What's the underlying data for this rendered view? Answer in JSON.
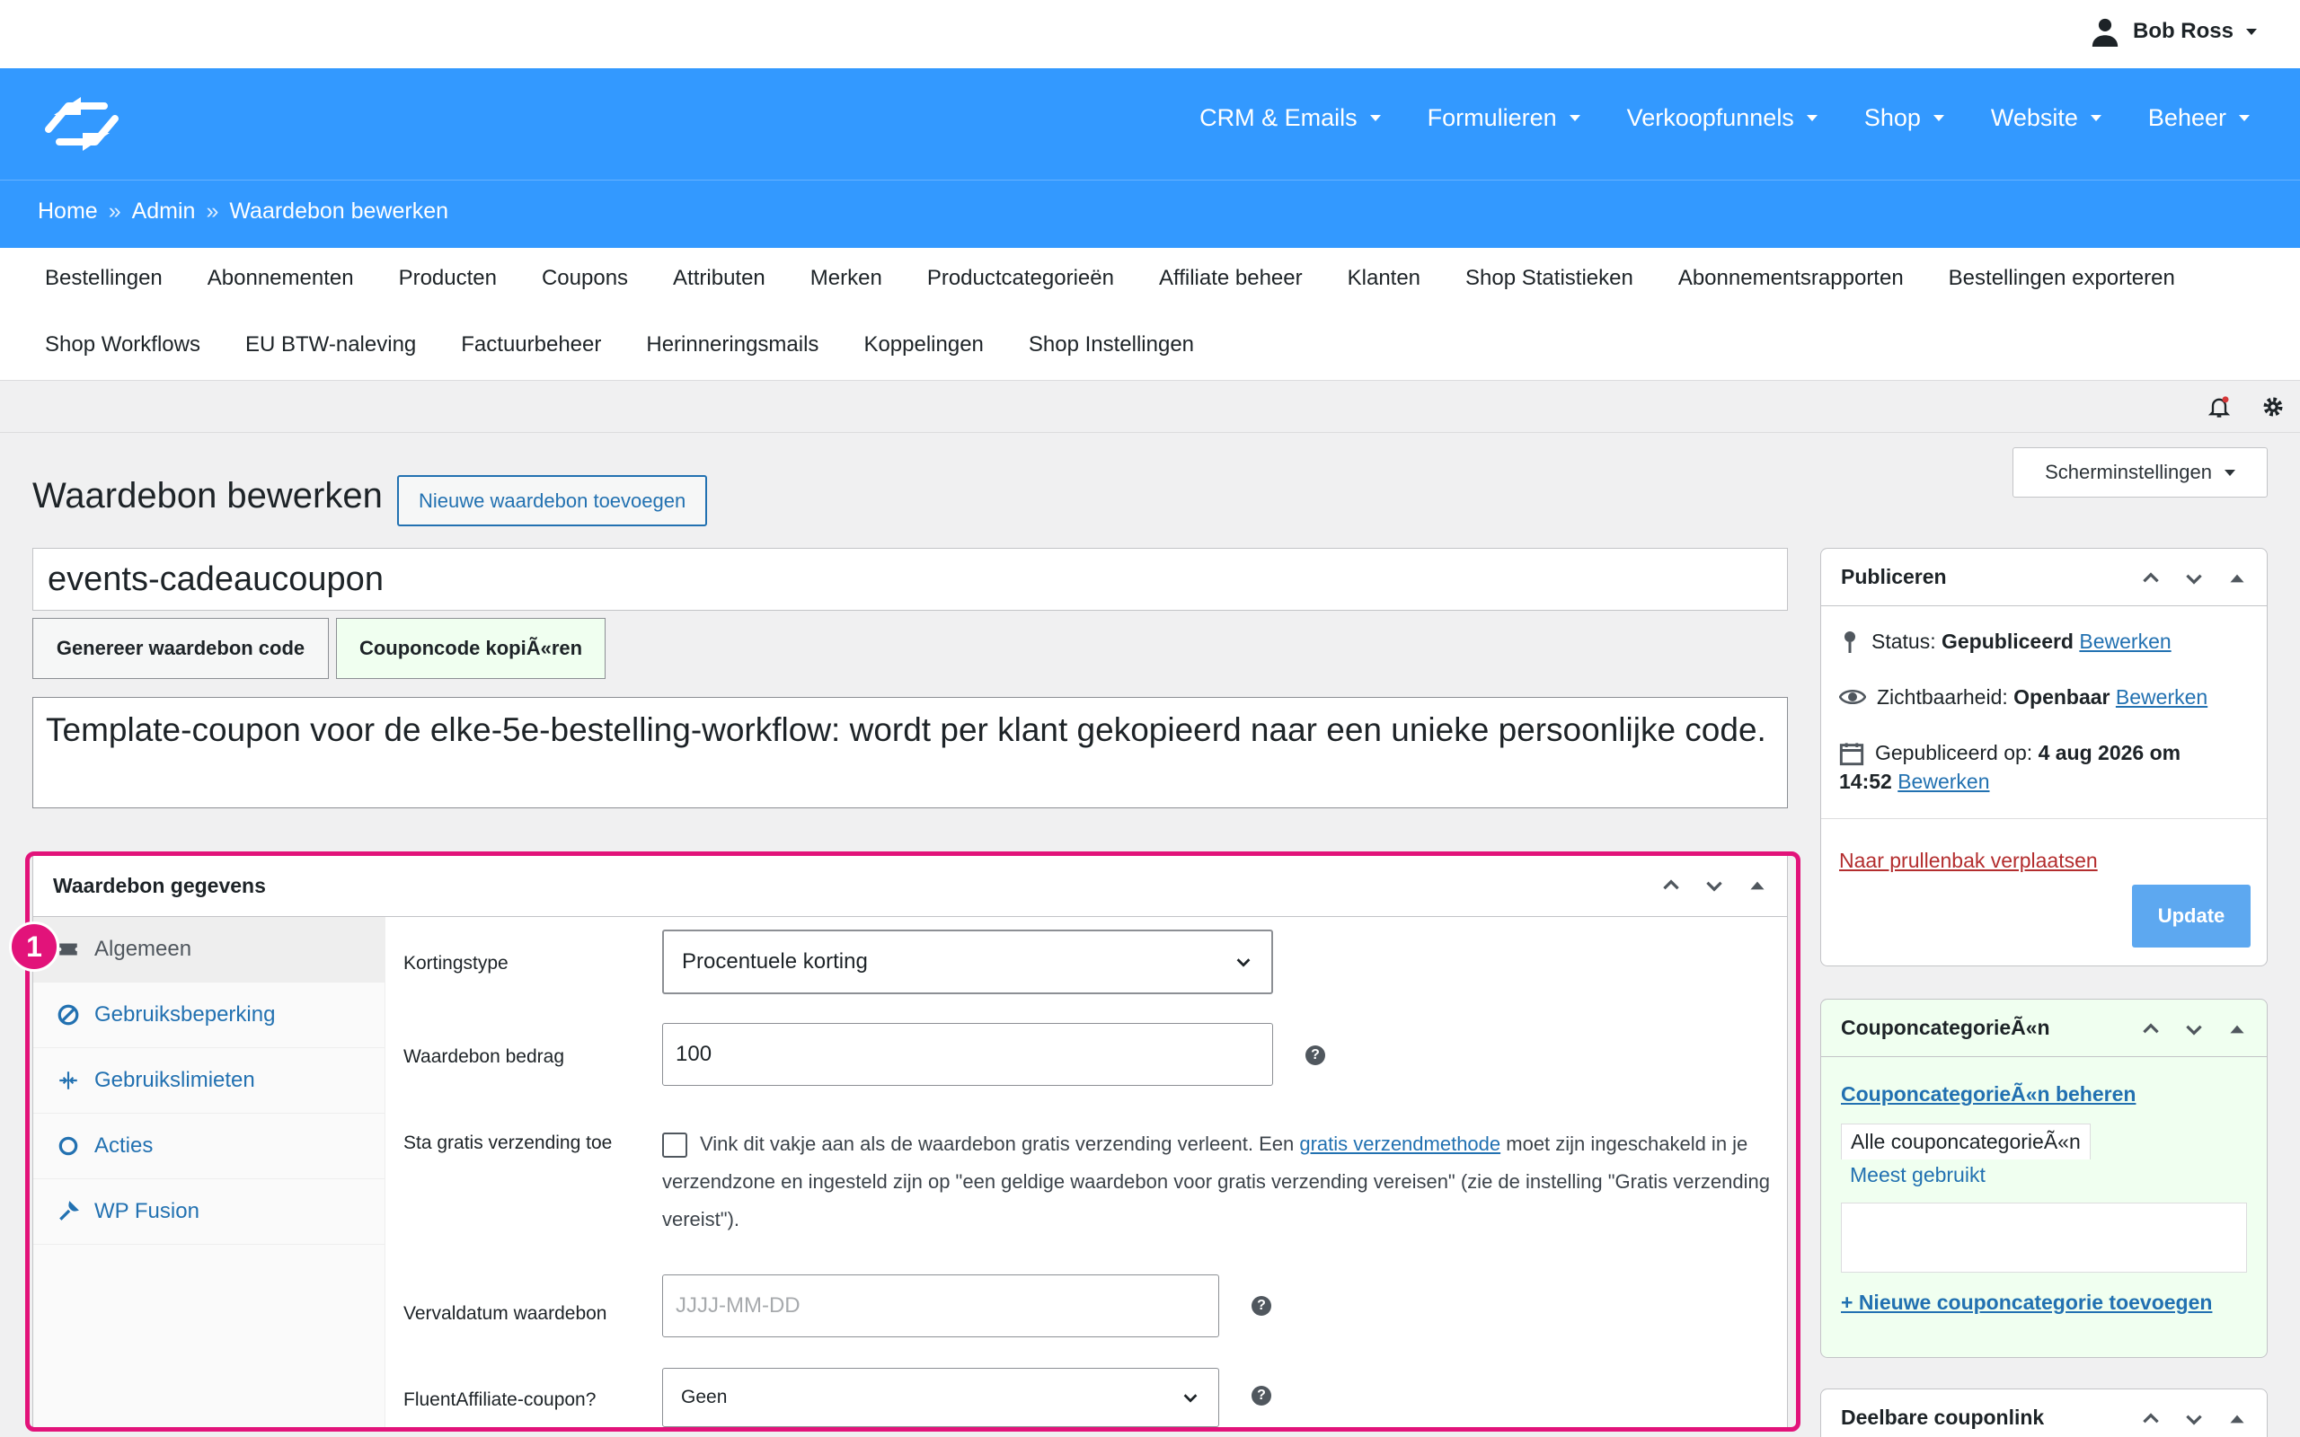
{
  "user": {
    "name": "Bob Ross"
  },
  "nav": {
    "items": [
      "CRM & Emails",
      "Formulieren",
      "Verkoopfunnels",
      "Shop",
      "Website",
      "Beheer"
    ]
  },
  "breadcrumb": {
    "home": "Home",
    "admin": "Admin",
    "current": "Waardebon bewerken",
    "sep": "»"
  },
  "subnav": {
    "row1": [
      "Bestellingen",
      "Abonnementen",
      "Producten",
      "Coupons",
      "Attributen",
      "Merken",
      "Productcategorieën",
      "Affiliate beheer",
      "Klanten",
      "Shop Statistieken",
      "Abonnementsrapporten",
      "Bestellingen exporteren"
    ],
    "row2": [
      "Shop Workflows",
      "EU BTW-naleving",
      "Factuurbeheer",
      "Herinneringsmails",
      "Koppelingen",
      "Shop Instellingen"
    ]
  },
  "screen_options": "Scherminstellingen",
  "page": {
    "title": "Waardebon bewerken",
    "add_new": "Nieuwe waardebon toevoegen",
    "coupon_code": "events-cadeaucoupon",
    "generate_btn": "Genereer waardebon code",
    "copy_btn": "Couponcode kopiÃ«ren",
    "description": "Template-coupon voor de elke-5e-bestelling-workflow: wordt per klant gekopieerd naar een unieke persoonlijke code."
  },
  "coupon_data": {
    "title": "Waardebon gegevens",
    "badge": "1",
    "tabs": [
      "Algemeen",
      "Gebruiksbeperking",
      "Gebruikslimieten",
      "Acties",
      "WP Fusion"
    ],
    "fields": {
      "discount_type_label": "Kortingstype",
      "discount_type_value": "Procentuele korting",
      "amount_label": "Waardebon bedrag",
      "amount_value": "100",
      "free_shipping_label": "Sta gratis verzending toe",
      "free_shipping_text_1": "Vink dit vakje aan als de waardebon gratis verzending verleent. Een ",
      "free_shipping_link": "gratis verzendmethode",
      "free_shipping_text_2": " moet zijn ingeschakeld in je verzendzone en ingesteld zijn op \"een geldige waardebon voor gratis verzending vereisen\" (zie de instelling \"Gratis verzending vereist\").",
      "expiry_label": "Vervaldatum waardebon",
      "expiry_placeholder": "JJJJ-MM-DD",
      "affiliate_label": "FluentAffiliate-coupon?",
      "affiliate_value": "Geen"
    }
  },
  "publish": {
    "title": "Publiceren",
    "status_label": "Status:",
    "status_value": "Gepubliceerd",
    "visibility_label": "Zichtbaarheid:",
    "visibility_value": "Openbaar",
    "published_label": "Gepubliceerd op:",
    "published_value_1": "4 aug 2026 om",
    "published_value_2": "14:52",
    "edit": "Bewerken",
    "trash": "Naar prullenbak verplaatsen",
    "update": "Update"
  },
  "categories": {
    "title": "CouponcategorieÃ«n",
    "manage": "CouponcategorieÃ«n beheren",
    "tab_all": "Alle couponcategorieÃ«n",
    "tab_popular": "Meest gebruikt",
    "add_new": "+ Nieuwe couponcategorie toevoegen"
  },
  "share": {
    "title": "Deelbare couponlink"
  },
  "colors": {
    "brand_blue": "#3399ff",
    "link": "#2271b1",
    "highlight": "#e2137a",
    "update_btn": "#5da8f0"
  }
}
